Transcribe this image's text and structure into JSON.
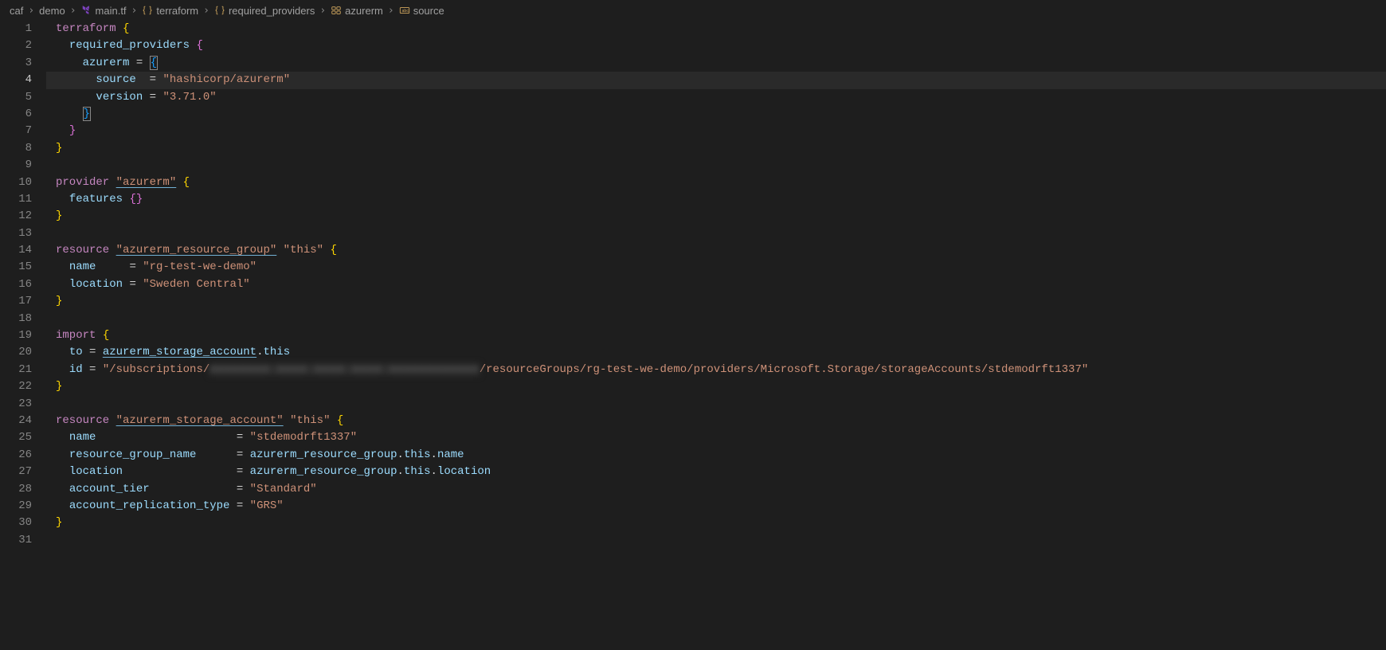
{
  "breadcrumb": {
    "items": [
      "caf",
      "demo",
      "main.tf",
      "terraform",
      "required_providers",
      "azurerm",
      "source"
    ]
  },
  "editor": {
    "current_line": 4,
    "total_lines": 31
  },
  "code": {
    "t_kw": "terraform",
    "req_prov": "required_providers",
    "azurerm": "azurerm",
    "source": "source",
    "source_val": "\"hashicorp/azurerm\"",
    "version": "version",
    "version_val": "\"3.71.0\"",
    "provider_kw": "provider",
    "provider_name": "\"azurerm\"",
    "features": "features",
    "resource_kw": "resource",
    "rg_type": "\"azurerm_resource_group\"",
    "this": "\"this\"",
    "name": "name",
    "rg_name_val": "\"rg-test-we-demo\"",
    "location": "location",
    "rg_loc_val": "\"Sweden Central\"",
    "import_kw": "import",
    "to": "to",
    "to_val_type": "azurerm_storage_account",
    "to_val_name": "this",
    "id": "id",
    "id_val_pre": "\"/subscriptions/",
    "id_val_redact": "xxxxxxxx-xxxx-xxxx-xxxx-xxxxxxxxxxxx",
    "id_val_post": "/resourceGroups/rg-test-we-demo/providers/Microsoft.Storage/storageAccounts/stdemodrft1337\"",
    "sa_type": "\"azurerm_storage_account\"",
    "sa_name_val": "\"stdemodrft1337\"",
    "rg_name_attr": "resource_group_name",
    "rg_ref": "azurerm_resource_group",
    "ref_this": "this",
    "ref_name": "name",
    "ref_loc": "location",
    "acct_tier": "account_tier",
    "acct_tier_val": "\"Standard\"",
    "acct_repl": "account_replication_type",
    "acct_repl_val": "\"GRS\""
  }
}
